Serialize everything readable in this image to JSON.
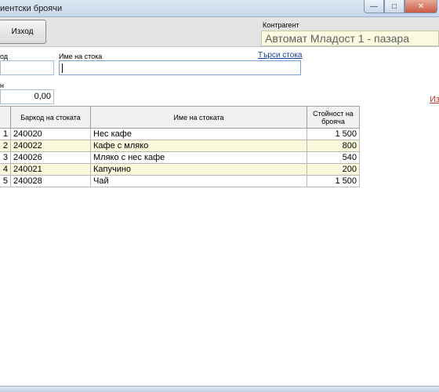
{
  "window": {
    "title": "иентски броячи",
    "minimize_glyph": "—",
    "maximize_glyph": "□",
    "close_glyph": "✕"
  },
  "toolbar": {
    "exit_label": "Изход",
    "counterparty_label": "Контрагент",
    "counterparty_value": "Автомат Младост 1 - пазара"
  },
  "form": {
    "code_label": "од",
    "name_label": "Име на стока",
    "name_value": "",
    "search_link": "Търси стока",
    "sum_label": "н",
    "sum_value": "0,00",
    "side_link": "Из"
  },
  "table": {
    "headers": {
      "num": "",
      "code": "Баркод на стоката",
      "name": "Име на стоката",
      "value": "Стойност на брояча"
    },
    "rows": [
      {
        "num": "1",
        "code": "240020",
        "name": "Нес кафе",
        "value": "1 500"
      },
      {
        "num": "2",
        "code": "240022",
        "name": "Кафе с мляко",
        "value": "800"
      },
      {
        "num": "3",
        "code": "240026",
        "name": "Мляко с нес кафе",
        "value": "540"
      },
      {
        "num": "4",
        "code": "240021",
        "name": "Капучино",
        "value": "200"
      },
      {
        "num": "5",
        "code": "240028",
        "name": "Чай",
        "value": "1 500"
      }
    ]
  }
}
